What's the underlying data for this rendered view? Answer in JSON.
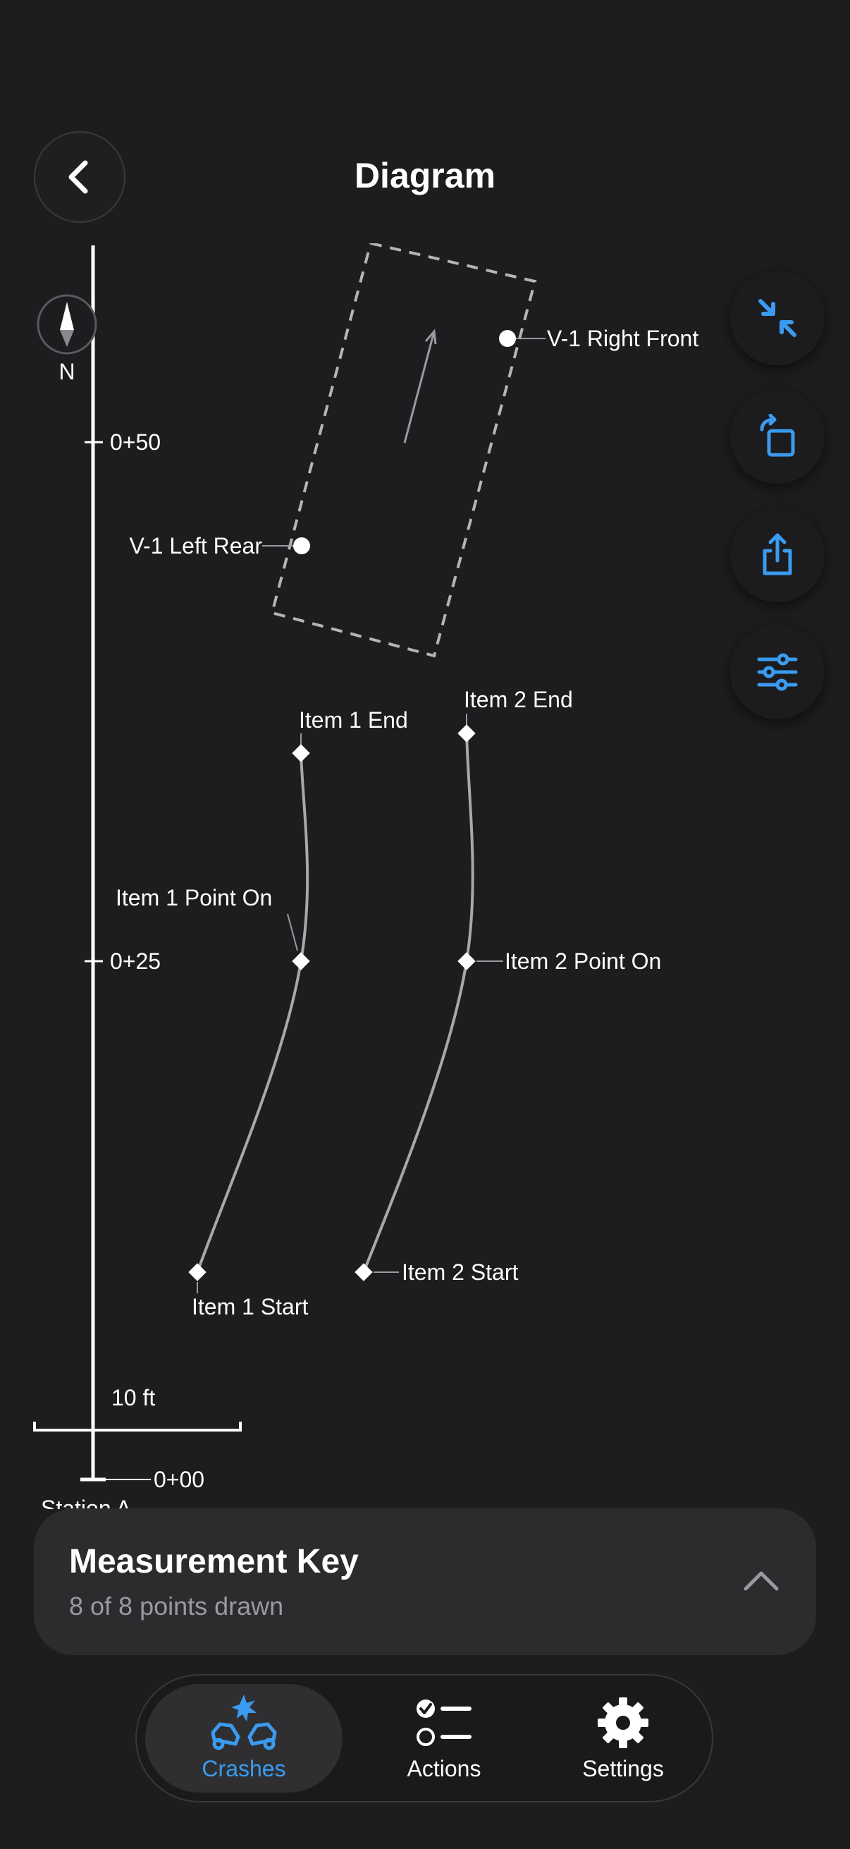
{
  "header": {
    "title": "Diagram"
  },
  "diagram": {
    "compass_label": "N",
    "stations": [
      "0+50",
      "0+25",
      "0+00"
    ],
    "station_base_label": "Station A",
    "scale_label": "10 ft",
    "points": {
      "v1_right_front": "V-1 Right Front",
      "v1_left_rear": "V-1 Left Rear",
      "item1_end": "Item 1 End",
      "item2_end": "Item 2 End",
      "item1_point_on": "Item 1 Point On",
      "item2_point_on": "Item 2 Point On",
      "item1_start": "Item 1 Start",
      "item2_start": "Item 2 Start"
    }
  },
  "tools": [
    "compress-icon",
    "rotate-icon",
    "share-icon",
    "sliders-icon"
  ],
  "measurement_key": {
    "title": "Measurement Key",
    "subtitle": "8 of 8 points drawn"
  },
  "tab_bar": {
    "tabs": [
      {
        "label": "Crashes",
        "selected": true
      },
      {
        "label": "Actions",
        "selected": false
      },
      {
        "label": "Settings",
        "selected": false
      }
    ]
  },
  "colors": {
    "background": "#1d1d1f",
    "accent": "#3a9bf0",
    "panel": "#2c2c2e",
    "secondary_text": "#9a9a9e"
  }
}
